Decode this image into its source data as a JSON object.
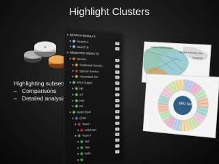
{
  "slide": {
    "title": "Highlight Clusters"
  },
  "bullets": {
    "lead": "Highlighting subsets",
    "items": [
      "Comparisons",
      "Detailed analysis"
    ],
    "dash": "–"
  },
  "icons": {
    "cylinders": [
      "cylinder-gray-icon",
      "cylinder-white-icon",
      "cylinder-orange-icon"
    ]
  },
  "tree": {
    "rows": [
      {
        "level": 0,
        "section": true,
        "label": "SEARCH RESULTS",
        "color": "",
        "count": ""
      },
      {
        "level": 1,
        "section": false,
        "label": "Search A",
        "color": "#9fc6e8",
        "count": "1"
      },
      {
        "level": 1,
        "section": false,
        "label": "Search B",
        "color": "#9fc6e8",
        "count": "1"
      },
      {
        "level": 0,
        "section": true,
        "label": "SELECTED OBJECTS",
        "color": "",
        "count": ""
      },
      {
        "level": 1,
        "section": false,
        "label": "Service",
        "color": "#e07a2a",
        "count": "3"
      },
      {
        "level": 2,
        "section": false,
        "label": "Traditional Service",
        "color": "#e5b04a",
        "count": "2"
      },
      {
        "level": 2,
        "section": false,
        "label": "Special Service",
        "color": "#c44b3a",
        "count": "1"
      },
      {
        "level": 2,
        "section": false,
        "label": "Automated Ser",
        "color": "#d9c24a",
        "count": "1"
      },
      {
        "level": 1,
        "section": false,
        "label": "KRU Output",
        "color": "#7fc46a",
        "count": "6"
      },
      {
        "level": 2,
        "section": false,
        "label": "NE",
        "color": "#7fc46a",
        "count": "2"
      },
      {
        "level": 2,
        "section": false,
        "label": "ST",
        "color": "#7fc46a",
        "count": "1"
      },
      {
        "level": 2,
        "section": false,
        "label": "NW",
        "color": "#7fc46a",
        "count": "1"
      },
      {
        "level": 2,
        "section": false,
        "label": "NC",
        "color": "#7fc46a",
        "count": "2"
      },
      {
        "level": 1,
        "section": false,
        "label": "Wells Bank",
        "color": "#8ab84a",
        "count": "4"
      },
      {
        "level": 2,
        "section": false,
        "label": "CRM",
        "color": "#3a8fd0",
        "count": "2"
      },
      {
        "level": 3,
        "section": false,
        "label": "Team I",
        "color": "#c03a3a",
        "count": "1"
      },
      {
        "level": 4,
        "section": false,
        "label": "Unknown",
        "color": "#c03a3a",
        "count": "1"
      },
      {
        "level": 3,
        "section": false,
        "label": "Team II",
        "color": "#4ab04a",
        "count": "3"
      },
      {
        "level": 4,
        "section": false,
        "label": "Ted",
        "color": "#4ab04a",
        "count": "1"
      },
      {
        "level": 4,
        "section": false,
        "label": "Tate",
        "color": "#4ab04a",
        "count": "1"
      },
      {
        "level": 4,
        "section": false,
        "label": "Sally",
        "color": "#4ab04a",
        "count": "1"
      },
      {
        "level": 4,
        "section": false,
        "label": "",
        "color": "#4ab04a",
        "count": ""
      }
    ]
  },
  "vis": {
    "top_labels": [
      "Grupo Central Bank",
      "Target Industry Dev",
      "Summer"
    ],
    "bottom_center_label": "KRU Server"
  }
}
